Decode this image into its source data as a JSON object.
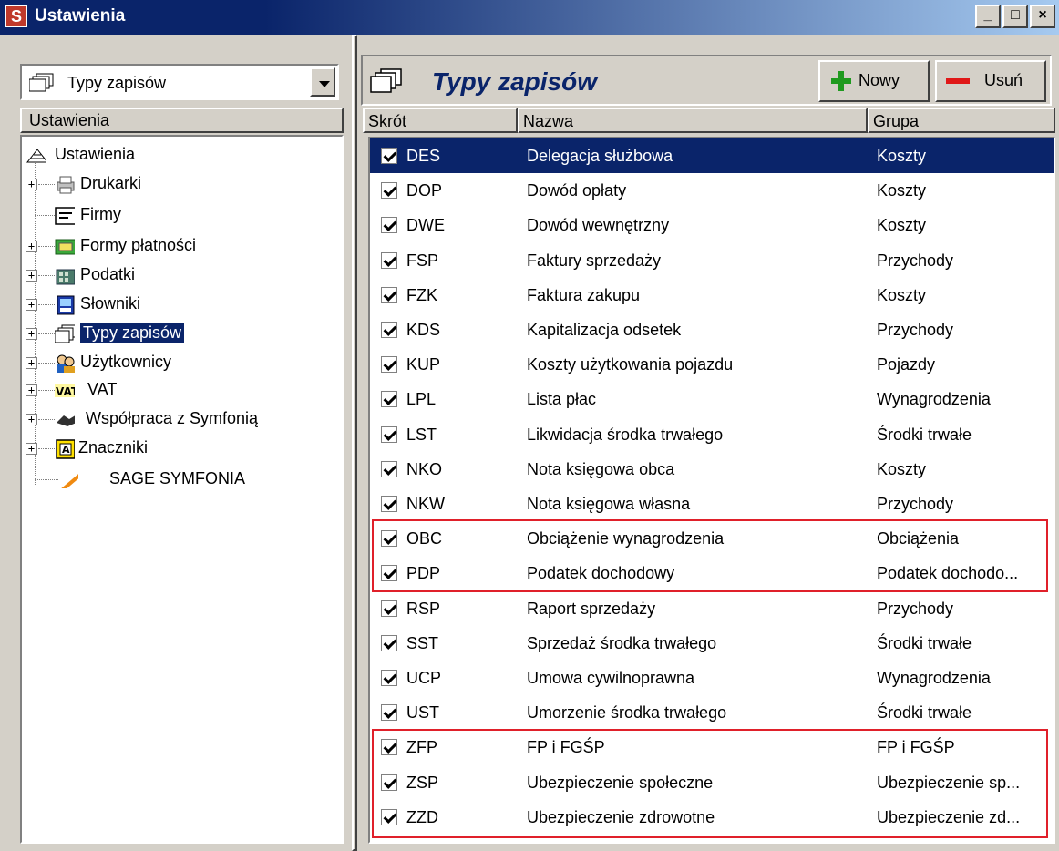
{
  "window": {
    "title": "Ustawienia",
    "app_icon_letter": "S"
  },
  "left": {
    "combo_value": "Typy zapisów",
    "header": "Ustawienia",
    "tree": [
      {
        "label": "Ustawienia",
        "icon": "settings-root-icon"
      },
      {
        "label": "Drukarki",
        "icon": "printer-icon"
      },
      {
        "label": "Firmy",
        "icon": "company-card-icon"
      },
      {
        "label": "Formy płatności",
        "icon": "payment-forms-icon"
      },
      {
        "label": "Podatki",
        "icon": "tax-icon"
      },
      {
        "label": "Słowniki",
        "icon": "dictionary-icon"
      },
      {
        "label": "Typy zapisów",
        "icon": "entry-types-icon"
      },
      {
        "label": "Użytkownicy",
        "icon": "users-icon"
      },
      {
        "label": "VAT",
        "icon": "vat-icon"
      },
      {
        "label": "Współpraca z Symfonią",
        "icon": "cooperation-icon"
      },
      {
        "label": "Znaczniki",
        "icon": "tags-icon"
      },
      {
        "label": "SAGE SYMFONIA",
        "icon": "sage-logo-icon"
      }
    ]
  },
  "right": {
    "title": "Typy zapisów",
    "new_label": "Nowy",
    "delete_label": "Usuń",
    "columns": [
      "Skrót",
      "Nazwa",
      "Grupa"
    ],
    "rows": [
      {
        "code": "DES",
        "name": "Delegacja służbowa",
        "group": "Koszty",
        "checked": true
      },
      {
        "code": "DOP",
        "name": "Dowód opłaty",
        "group": "Koszty",
        "checked": true
      },
      {
        "code": "DWE",
        "name": "Dowód wewnętrzny",
        "group": "Koszty",
        "checked": true
      },
      {
        "code": "FSP",
        "name": "Faktury sprzedaży",
        "group": "Przychody",
        "checked": true
      },
      {
        "code": "FZK",
        "name": "Faktura zakupu",
        "group": "Koszty",
        "checked": true
      },
      {
        "code": "KDS",
        "name": "Kapitalizacja odsetek",
        "group": "Przychody",
        "checked": true
      },
      {
        "code": "KUP",
        "name": "Koszty użytkowania pojazdu",
        "group": "Pojazdy",
        "checked": true
      },
      {
        "code": "LPL",
        "name": "Lista płac",
        "group": "Wynagrodzenia",
        "checked": true
      },
      {
        "code": "LST",
        "name": "Likwidacja środka trwałego",
        "group": "Środki trwałe",
        "checked": true
      },
      {
        "code": "NKO",
        "name": "Nota księgowa obca",
        "group": "Koszty",
        "checked": true
      },
      {
        "code": "NKW",
        "name": "Nota księgowa własna",
        "group": "Przychody",
        "checked": true
      },
      {
        "code": "OBC",
        "name": "Obciążenie wynagrodzenia",
        "group": "Obciążenia",
        "checked": true
      },
      {
        "code": "PDP",
        "name": "Podatek dochodowy",
        "group": "Podatek dochodo...",
        "checked": true
      },
      {
        "code": "RSP",
        "name": "Raport sprzedaży",
        "group": "Przychody",
        "checked": true
      },
      {
        "code": "SST",
        "name": "Sprzedaż środka trwałego",
        "group": "Środki trwałe",
        "checked": true
      },
      {
        "code": "UCP",
        "name": "Umowa cywilnoprawna",
        "group": "Wynagrodzenia",
        "checked": true
      },
      {
        "code": "UST",
        "name": "Umorzenie środka trwałego",
        "group": "Środki trwałe",
        "checked": true
      },
      {
        "code": "ZFP",
        "name": "FP i FGŚP",
        "group": "FP i FGŚP",
        "checked": true
      },
      {
        "code": "ZSP",
        "name": "Ubezpieczenie społeczne",
        "group": "Ubezpieczenie sp...",
        "checked": true
      },
      {
        "code": "ZZD",
        "name": "Ubezpieczenie zdrowotne",
        "group": "Ubezpieczenie zd...",
        "checked": true
      }
    ]
  },
  "colors": {
    "selection": "#0a246a",
    "highlight": "#e0202a",
    "accent_green": "#1f9a1f",
    "accent_red": "#e01818"
  }
}
